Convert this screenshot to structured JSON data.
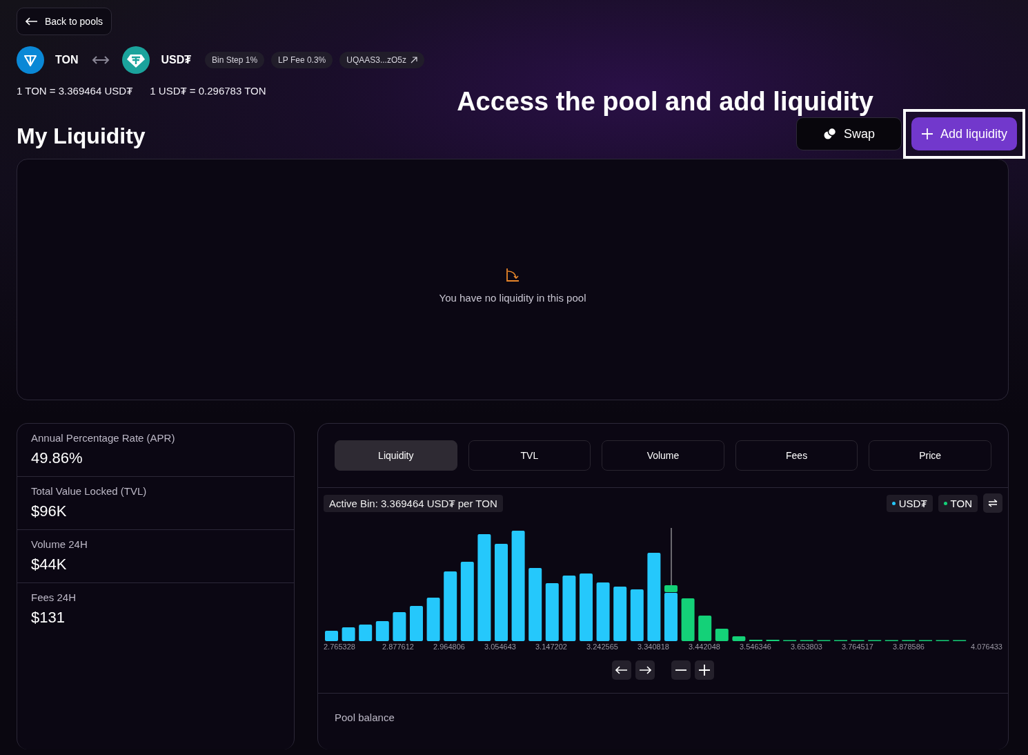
{
  "back_button": {
    "label": "Back to pools"
  },
  "pair": {
    "base": {
      "symbol": "TON"
    },
    "quote": {
      "symbol": "USD₮"
    },
    "tags": [
      {
        "label": "Bin Step 1%",
        "kind": "info"
      },
      {
        "label": "LP Fee 0.3%",
        "kind": "info"
      },
      {
        "label": "UQAAS3...zO5z",
        "kind": "link"
      }
    ]
  },
  "rates": [
    "1 TON = 3.369464 USD₮",
    "1 USD₮ = 0.296783 TON"
  ],
  "section_title": "My Liquidity",
  "annotation": {
    "text": "Access the pool and add liquidity"
  },
  "actions": [
    {
      "label": "Swap",
      "kind": "secondary",
      "highlighted": false
    },
    {
      "label": "Add liquidity",
      "kind": "primary",
      "highlighted": true
    }
  ],
  "empty_state": {
    "message": "You have no liquidity in this pool"
  },
  "stats": [
    {
      "label": "Annual Percentage Rate (APR)",
      "value": "49.86%"
    },
    {
      "label": "Total Value Locked (TVL)",
      "value": "$96K"
    },
    {
      "label": "Volume 24H",
      "value": "$44K"
    },
    {
      "label": "Fees 24H",
      "value": "$131"
    }
  ],
  "chart_panel": {
    "tabs": [
      {
        "label": "Liquidity",
        "selected": true
      },
      {
        "label": "TVL",
        "selected": false
      },
      {
        "label": "Volume",
        "selected": false
      },
      {
        "label": "Fees",
        "selected": false
      },
      {
        "label": "Price",
        "selected": false
      }
    ],
    "active_bin": "Active Bin: 3.369464 USD₮ per TON",
    "legend": [
      {
        "label": "USD₮",
        "color": "#25c8fc"
      },
      {
        "label": "TON",
        "color": "#14d178"
      }
    ],
    "axis_labels": [
      "2.765328",
      "2.877612",
      "2.964806",
      "3.054643",
      "3.147202",
      "3.242565",
      "3.340818",
      "3.442048",
      "3.546346",
      "3.653803",
      "3.764517",
      "3.878586",
      "4.076433"
    ]
  },
  "pool_balance": {
    "title": "Pool balance"
  }
}
